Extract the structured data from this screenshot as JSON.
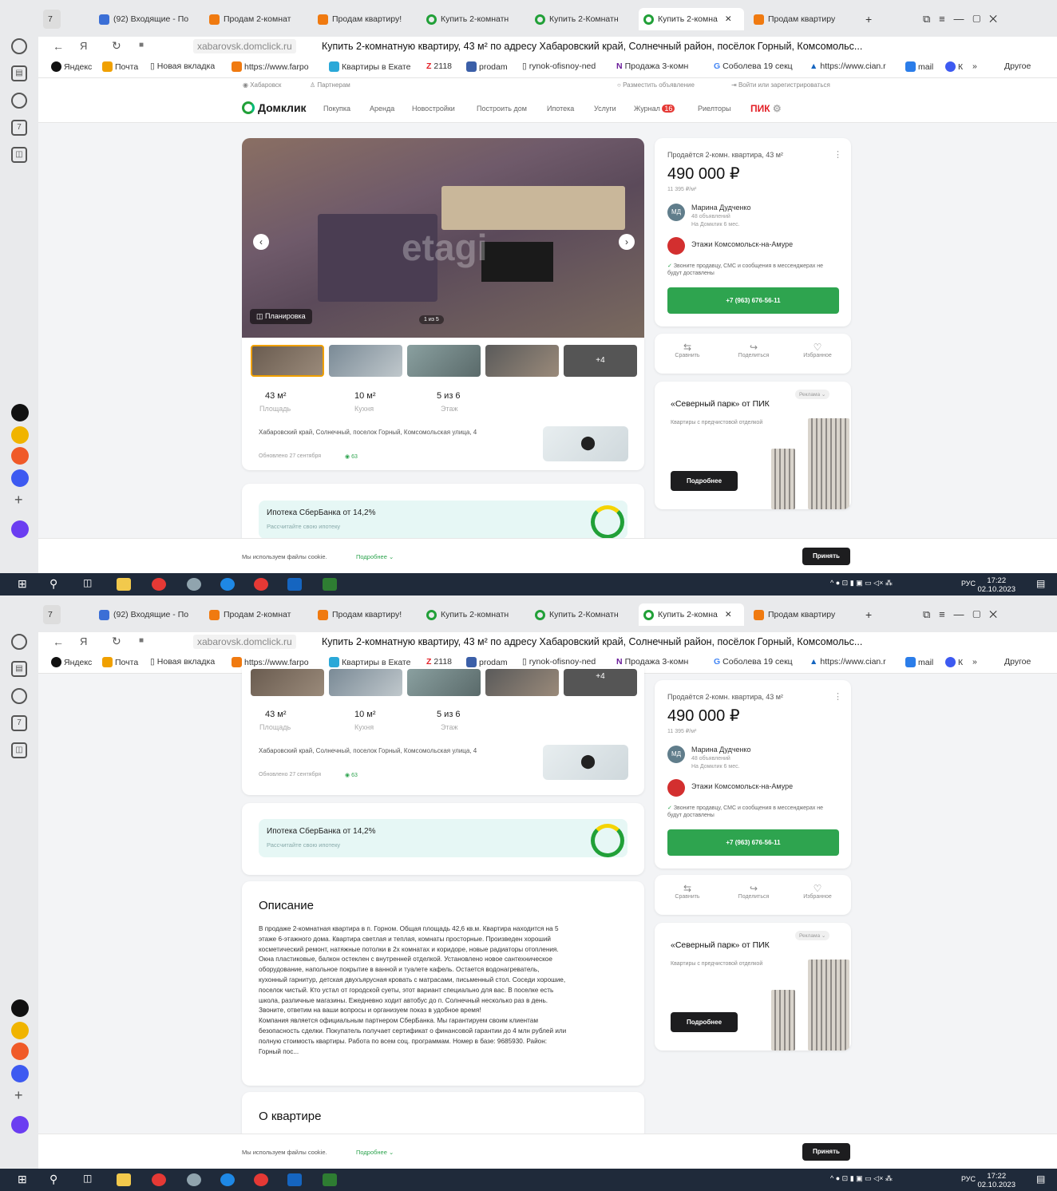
{
  "browser": {
    "tabs": [
      {
        "label": "7",
        "kind": "counter"
      },
      {
        "label": "(92) Входящие - По",
        "kind": "mail"
      },
      {
        "label": "Продам 2-комнат",
        "kind": "farpost"
      },
      {
        "label": "Продам квартиру!",
        "kind": "farpost"
      },
      {
        "label": "Купить 2-комнатн",
        "kind": "domclick"
      },
      {
        "label": "Купить 2-Комнатн",
        "kind": "domclick"
      },
      {
        "label": "Купить 2-комна",
        "kind": "domclick",
        "active": true
      },
      {
        "label": "Продам квартиру",
        "kind": "farpost"
      }
    ],
    "domain": "xabarovsk.domclick.ru",
    "page_title": "Купить 2-комнатную квартиру, 43 м² по адресу Хабаровский край, Солнечный район, посёлок Горный, Комсомольс...",
    "bookmarks": [
      "Яндекс",
      "Почта",
      "Новая вкладка",
      "https://www.farpo",
      "Квартиры в Екате",
      "2118",
      "prodam",
      "rynok-ofisnoy-ned",
      "Продажа 3-комн",
      "Соболева 19 секц",
      "https://www.cian.r",
      "mail",
      "К",
      "»",
      "Другое"
    ]
  },
  "location_bar": {
    "city": "Хабаровск",
    "partners": "Партнерам",
    "post_ad": "Разместить объявление",
    "login": "Войти или зарегистрироваться"
  },
  "site": {
    "logo": "Домклик",
    "nav": [
      "Покупка",
      "Аренда",
      "Новостройки",
      "Построить дом",
      "Ипотека",
      "Услуги",
      "Журнал",
      "Риелторы"
    ],
    "journal_badge": "16",
    "pik": "ПИК"
  },
  "gallery": {
    "plan_label": "Планировка",
    "counter": "1 из 5",
    "more_label": "+4",
    "watermark": "etagi"
  },
  "facts": [
    {
      "value": "43 м²",
      "label": "Площадь"
    },
    {
      "value": "10 м²",
      "label": "Кухня"
    },
    {
      "value": "5 из 6",
      "label": "Этаж"
    }
  ],
  "address": "Хабаровский край, Солнечный, поселок Горный, Комсомольская улица, 4",
  "updated": "Обновлено 27 сентября",
  "views": "63",
  "mortgage": {
    "title": "Ипотека СберБанка от 14,2%",
    "subtitle": "Рассчитайте свою ипотеку"
  },
  "offer": {
    "title": "Продаётся 2-комн. квартира, 43 м²",
    "price": "490 000 ₽",
    "price_per_m": "11 395 ₽/м²",
    "agent_initials": "МД",
    "agent_name": "Марина Дудченко",
    "agent_ads": "48 объявлений",
    "agent_since": "На Домклик 6 мес.",
    "agency": "Этажи Комсомольск-на-Амуре",
    "notice": "Звоните продавцу, СМС и сообщения в мессенджерах не будут доставлены",
    "phone": "+7 (963) 676-56-11",
    "actions": [
      "Сравнить",
      "Поделиться",
      "Избранное"
    ]
  },
  "ad": {
    "badge": "Реклама",
    "title": "«Северный парк» от ПИК",
    "text": "Квартиры с предчистовой отделкой",
    "button": "Подробнее"
  },
  "description": {
    "heading": "Описание",
    "lines": [
      "В продаже 2-комнатная квартира в п. Горном. Общая площадь 42,6 кв.м. Квартира находится на 5",
      "этаже 6-этажного дома. Квартира светлая и теплая, комнаты просторные. Произведен хороший",
      "косметический ремонт, натяжные потолки в 2х комнатах и коридоре, новые радиаторы отопления.",
      "Окна пластиковые, балкон остеклен с внутренней отделкой. Установлено новое сантехническое",
      "оборудование, напольное покрытие в ванной и туалете кафель. Остается водонагреватель,",
      "кухонный гарнитур, детская двухъярусная кровать с матрасами, письменный стол. Соседи хорошие,",
      "поселок чистый. Кто устал от городской суеты, этот вариант специально для вас. В поселке есть",
      "школа, различные магазины. Ежедневно ходит автобус до п. Солнечный несколько раз в день.",
      "Звоните, ответим на ваши вопросы и организуем показ в удобное время!",
      "Компания является официальным партнером СберБанка. Мы гарантируем своим клиентам",
      "безопасность сделки. Покупатель получает сертификат о финансовой гарантии до 4 млн рублей или",
      "полную стоимость квартиры. Работа по всем соц. программам. Номер в базе: 9685930. Район:",
      "Горный пос..."
    ]
  },
  "about_heading": "О квартире",
  "cookie": {
    "text": "Мы используем файлы cookie.",
    "more": "Подробнее",
    "accept": "Принять"
  },
  "taskbar": {
    "lang": "РУС",
    "time": "17:22",
    "date": "02.10.2023"
  },
  "colors": {
    "accent_green": "#2ea44f",
    "pik_red": "#e31f26",
    "sber_bg": "#e6f7f5",
    "taskbar": "#1f2a3a"
  }
}
